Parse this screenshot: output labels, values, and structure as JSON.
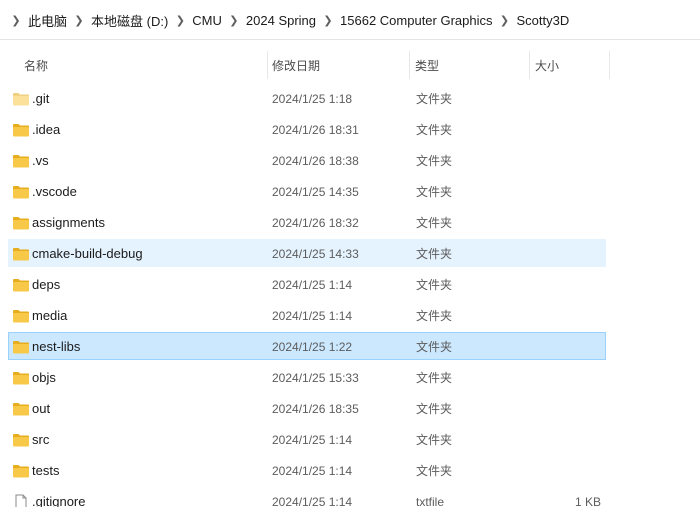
{
  "breadcrumb": [
    "此电脑",
    "本地磁盘 (D:)",
    "CMU",
    "2024 Spring",
    "15662 Computer Graphics",
    "Scotty3D"
  ],
  "columns": {
    "name": "名称",
    "date": "修改日期",
    "type": "类型",
    "size": "大小"
  },
  "colors": {
    "folder": "#f8c948",
    "folder_dark": "#e6ad1f",
    "hover_row": "#e5f3ff",
    "selected_row": "#cce8ff",
    "selected_border": "#99d1ff"
  },
  "files": [
    {
      "name": ".git",
      "date": "2024/1/25 1:18",
      "type": "文件夹",
      "size": "",
      "icon": "folder-icon",
      "state": "normal",
      "faded": true
    },
    {
      "name": ".idea",
      "date": "2024/1/26 18:31",
      "type": "文件夹",
      "size": "",
      "icon": "folder-icon",
      "state": "normal"
    },
    {
      "name": ".vs",
      "date": "2024/1/26 18:38",
      "type": "文件夹",
      "size": "",
      "icon": "folder-icon",
      "state": "normal"
    },
    {
      "name": ".vscode",
      "date": "2024/1/25 14:35",
      "type": "文件夹",
      "size": "",
      "icon": "folder-icon",
      "state": "normal"
    },
    {
      "name": "assignments",
      "date": "2024/1/26 18:32",
      "type": "文件夹",
      "size": "",
      "icon": "folder-icon",
      "state": "normal"
    },
    {
      "name": "cmake-build-debug",
      "date": "2024/1/25 14:33",
      "type": "文件夹",
      "size": "",
      "icon": "folder-icon",
      "state": "hover"
    },
    {
      "name": "deps",
      "date": "2024/1/25 1:14",
      "type": "文件夹",
      "size": "",
      "icon": "folder-icon",
      "state": "normal"
    },
    {
      "name": "media",
      "date": "2024/1/25 1:14",
      "type": "文件夹",
      "size": "",
      "icon": "folder-icon",
      "state": "normal"
    },
    {
      "name": "nest-libs",
      "date": "2024/1/25 1:22",
      "type": "文件夹",
      "size": "",
      "icon": "folder-icon",
      "state": "selected"
    },
    {
      "name": "objs",
      "date": "2024/1/25 15:33",
      "type": "文件夹",
      "size": "",
      "icon": "folder-icon",
      "state": "normal"
    },
    {
      "name": "out",
      "date": "2024/1/26 18:35",
      "type": "文件夹",
      "size": "",
      "icon": "folder-icon",
      "state": "normal"
    },
    {
      "name": "src",
      "date": "2024/1/25 1:14",
      "type": "文件夹",
      "size": "",
      "icon": "folder-icon",
      "state": "normal"
    },
    {
      "name": "tests",
      "date": "2024/1/25 1:14",
      "type": "文件夹",
      "size": "",
      "icon": "folder-icon",
      "state": "normal"
    },
    {
      "name": ".gitignore",
      "date": "2024/1/25 1:14",
      "type": "txtfile",
      "size": "1 KB",
      "icon": "text-file-icon",
      "state": "normal"
    }
  ]
}
